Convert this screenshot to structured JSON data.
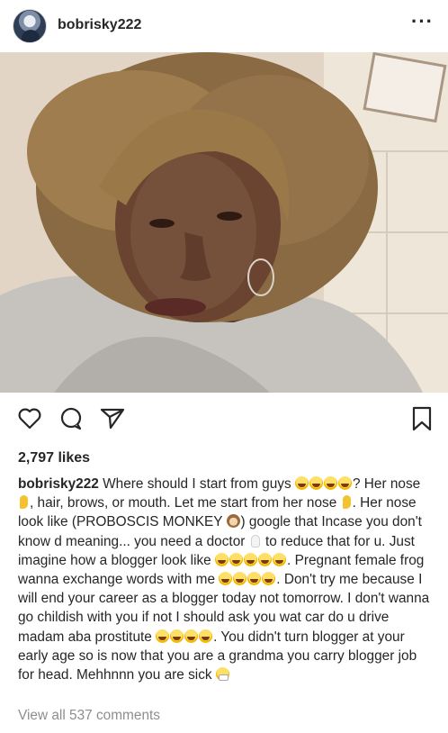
{
  "post": {
    "username": "bobrisky222",
    "more_icon": "ellipsis-icon",
    "likes": "2,797 likes",
    "caption": {
      "username": "bobrisky222",
      "p1": "Where should I start from guys",
      "p2": "?",
      "p3": "Her nose",
      "p4": ", hair, brows, or mouth. Let me start from her nose",
      "p5": ". Her nose look like (PROBOSCIS MONKEY",
      "p6": ") google that Incase you don't know d meaning... you need a doctor",
      "p7": "to reduce that for u. Just imagine how a blogger look like",
      "p8": ". Pregnant female frog wanna exchange words with me",
      "p9": ". Don't try me because I will end your career as a blogger today not tomorrow. I don't wanna go childish with you if not I should ask you wat car do u drive madam aba prostitute",
      "p10": ". You didn't turn blogger at your early age so is now that you are a grandma you carry blogger job for head. Mehhnnn you are sick"
    },
    "view_comments": "View all 537 comments"
  },
  "icons": {
    "like": "heart-icon",
    "comment": "comment-icon",
    "share": "send-icon",
    "save": "bookmark-icon"
  }
}
